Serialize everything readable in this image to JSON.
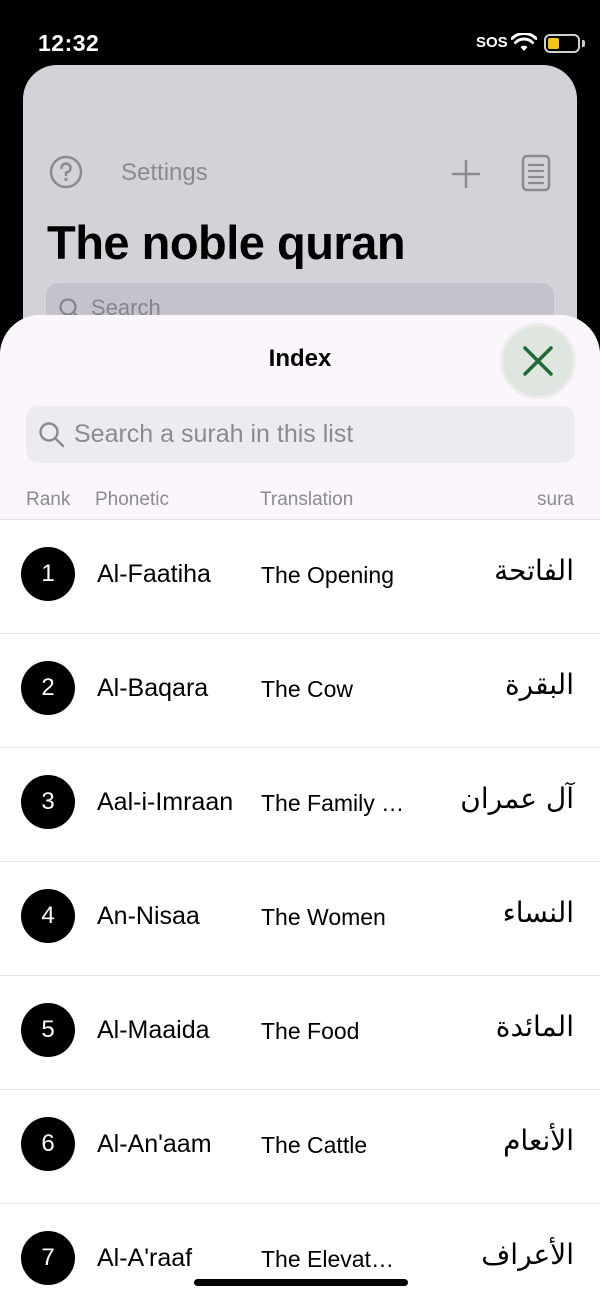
{
  "status_bar": {
    "time": "12:32",
    "sos": "SOS",
    "battery_level": 0.4,
    "battery_color": "#f5c518"
  },
  "background_view": {
    "settings_label": "Settings",
    "title": "The noble quran",
    "search_placeholder": "Search",
    "icons": [
      "help-icon",
      "plus-icon",
      "notes-icon"
    ]
  },
  "sheet": {
    "title": "Index",
    "close_icon": "close-icon",
    "accent": "#1e6b35",
    "search_placeholder": "Search a surah in this list",
    "columns": {
      "rank": "Rank",
      "phonetic": "Phonetic",
      "translation": "Translation",
      "sura": "sura"
    },
    "rows": [
      {
        "rank": "1",
        "phonetic": "Al-Faatiha",
        "translation": "The Opening",
        "arabic": "الفاتحة"
      },
      {
        "rank": "2",
        "phonetic": "Al-Baqara",
        "translation": "The Cow",
        "arabic": "البقرة"
      },
      {
        "rank": "3",
        "phonetic": "Aal-i-Imraan",
        "translation": "The Family of Imraan",
        "arabic": "آل عمران"
      },
      {
        "rank": "4",
        "phonetic": "An-Nisaa",
        "translation": "The Women",
        "arabic": "النساء"
      },
      {
        "rank": "5",
        "phonetic": "Al-Maaida",
        "translation": "The Food",
        "arabic": "المائدة"
      },
      {
        "rank": "6",
        "phonetic": "Al-An'aam",
        "translation": "The Cattle",
        "arabic": "الأنعام"
      },
      {
        "rank": "7",
        "phonetic": "Al-A'raaf",
        "translation": "The Elevated Places",
        "arabic": "الأعراف"
      }
    ]
  }
}
